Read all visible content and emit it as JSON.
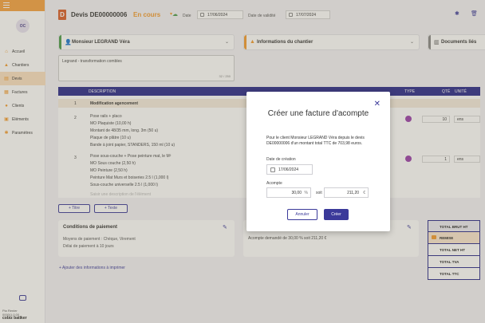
{
  "sidebar": {
    "avatar": "OC",
    "items": [
      {
        "label": "Accueil",
        "icon": "home-icon",
        "active": false
      },
      {
        "label": "Chantiers",
        "icon": "cone-icon",
        "active": false
      },
      {
        "label": "Devis",
        "icon": "quote-icon",
        "active": true
      },
      {
        "label": "Factures",
        "icon": "invoice-icon",
        "active": false
      },
      {
        "label": "Clients",
        "icon": "clients-icon",
        "active": false
      },
      {
        "label": "Eléments",
        "icon": "elements-icon",
        "active": false
      },
      {
        "label": "Paramètres",
        "icon": "gear-icon",
        "active": false
      }
    ],
    "user": "Pia Renier",
    "version": "0000/1.0.00",
    "brand": "cobiz batiker"
  },
  "header": {
    "badge": "D",
    "title": "Devis DE00000006",
    "status": "En cours",
    "date_label": "Date",
    "date_value": "17/06/2024",
    "validity_label": "Date de validité",
    "validity_value": "17/07/2024"
  },
  "panels": {
    "client": "Monsieur LEGRAND Véra",
    "chantier": "Informations du chantier",
    "documents": "Documents liés"
  },
  "notes": {
    "text": "Legrand - transformation combles",
    "counter": "32 / 250"
  },
  "table": {
    "headers": {
      "description": "DESCRIPTION",
      "type": "TYPE",
      "qte": "QTÉ",
      "unite": "UNITÉ"
    },
    "section_num": "1",
    "section_title": "Modification agencement",
    "row1_num": "2",
    "row1_lines": [
      "Pose rails + placo",
      "MO Plaquiste (10,00 h)",
      "Montant de 48/35 mm, long. 3m (50 u)",
      "Plaque de plâtre (10 u)",
      "Bande à joint papier, STANDERS, 150 ml (10 u)"
    ],
    "row1_qty": "10",
    "row1_unit": "ens",
    "row2_num": "3",
    "row2_lines": [
      "Pose sous-couche + Pose peinture mat, le M²",
      "MO Sous couche (2,50 h)",
      "MO Peinture (2,50 h)",
      "Peinture Mat Murs et boiseries 2.5 l (1,000 l)",
      "Sous-couche universelle 2.5 l (1,000 l)"
    ],
    "row2_qty": "1",
    "row2_unit": "ens",
    "placeholder": "Saisir une description de l'élément"
  },
  "buttons": {
    "add_title": "+ Titre",
    "add_text": "+ Texte",
    "add_info": "+ Ajouter des informations à imprimer"
  },
  "conditions": {
    "title": "Conditions de paiement",
    "line1": "Moyens de paiement : Chèque, Virement",
    "line2": "Délai de paiement à 10 jours"
  },
  "acompte_panel": {
    "text": "Acompte demandé de 30,00 % soit 211,20 €"
  },
  "totals": [
    {
      "label": "TOTAL BRUT HT"
    },
    {
      "label": "REMISE"
    },
    {
      "label": "TOTAL NET HT"
    },
    {
      "label": "TOTAL TVA"
    },
    {
      "label": "TOTAL TTC"
    }
  ],
  "modal": {
    "title": "Créer une facture d'acompte",
    "description": "Pour le client Monsieur LEGRAND Véra depuis le devis DE00000006 d'un montant total TTC de 703,98 euros.",
    "date_label": "Date de création",
    "date_value": "17/06/2024",
    "acompte_label": "Acompte",
    "percent_value": "30,00",
    "percent_unit": "%",
    "soit": "soit",
    "amount_value": "211,20",
    "amount_unit": "€",
    "cancel": "Annuler",
    "confirm": "Créer"
  },
  "colors": {
    "accent": "#f39a2d",
    "primary": "#28288a",
    "quote": "#d95d29"
  }
}
